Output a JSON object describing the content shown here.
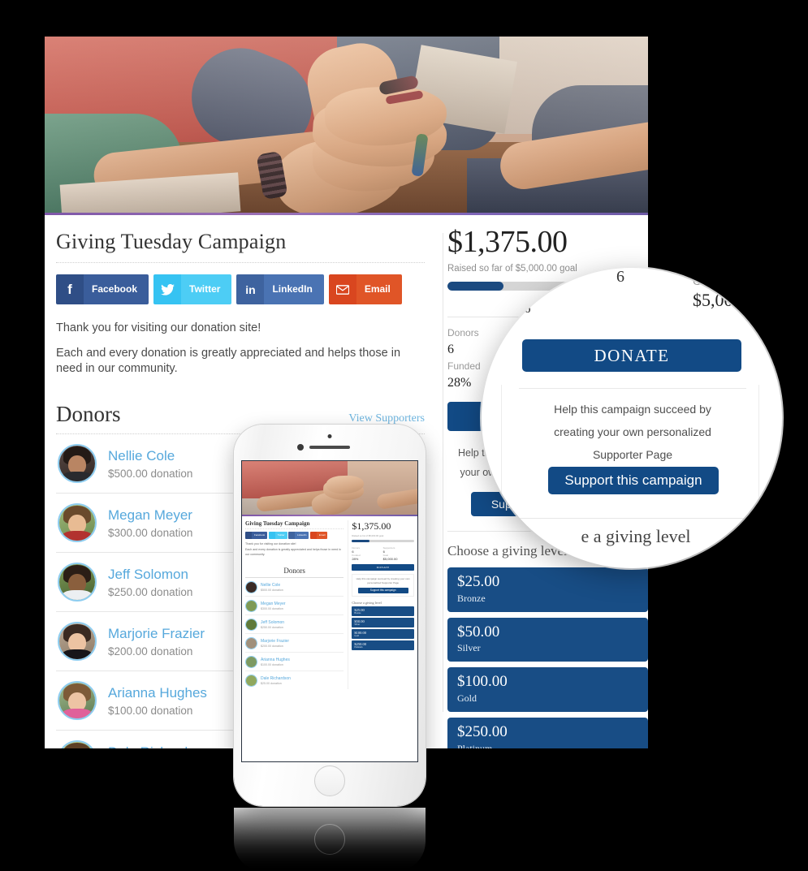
{
  "campaign": {
    "title": "Giving Tuesday Campaign",
    "intro_1": "Thank you for visiting our donation site!",
    "intro_2": "Each and every donation is greatly appreciated and helps those in need in our community."
  },
  "social": [
    {
      "name": "facebook",
      "glyph": "f",
      "label": "Facebook"
    },
    {
      "name": "twitter",
      "glyph": "ᵠ",
      "label": "Twitter"
    },
    {
      "name": "linkedin",
      "glyph": "in",
      "label": "LinkedIn"
    },
    {
      "name": "email",
      "glyph": "✉",
      "label": "Email"
    }
  ],
  "donors_section": {
    "heading": "Donors",
    "view_supporters": "View Supporters",
    "list": [
      {
        "name": "Nellie Cole",
        "amount": "$500.00 donation"
      },
      {
        "name": "Megan Meyer",
        "amount": "$300.00 donation"
      },
      {
        "name": "Jeff Solomon",
        "amount": "$250.00 donation"
      },
      {
        "name": "Marjorie Frazier",
        "amount": "$200.00 donation"
      },
      {
        "name": "Arianna Hughes",
        "amount": "$100.00 donation"
      },
      {
        "name": "Dale Richardson",
        "amount": "$25.00 donation"
      }
    ]
  },
  "progress": {
    "amount_raised": "$1,375.00",
    "raised_subtitle": "Raised so far of $5,000.00 goal",
    "percent_fill": 28,
    "percent_label": "%",
    "donors_label": "Donors",
    "donors_value": "6",
    "supporters_label": "Supporters",
    "supporters_value": "6",
    "funded_label": "Funded",
    "funded_value": "28%",
    "goal_label": "Goal",
    "goal_value": "$5,000.00"
  },
  "actions": {
    "donate": "DONATE",
    "help_text": "Help this campaign succeed by creating your own personalized Supporter Page",
    "help_line_1": "Help this campaign succeed by",
    "help_line_2": "creating your own personalized",
    "help_line_3": "Supporter Page",
    "support": "Support this campaign",
    "support_short": "Sup"
  },
  "giving": {
    "heading": "Choose a giving level",
    "heading_partial": "e a giving level",
    "levels": [
      {
        "amount": "$25.00",
        "tier": "Bronze"
      },
      {
        "amount": "$50.00",
        "tier": "Silver"
      },
      {
        "amount": "$100.00",
        "tier": "Gold"
      },
      {
        "amount": "$250.00",
        "tier": "Platinum"
      }
    ]
  },
  "colors": {
    "navy": "#124a85",
    "level_blue": "#184d85",
    "progress_fill": "#1b4a80",
    "progress_track": "#d5d5d5",
    "donor_link": "#56a8dc",
    "supporters_link": "#6fb6e0",
    "facebook": "#3a5d9b",
    "twitter": "#4dcdf5",
    "linkedin": "#4a73b3",
    "email": "#e05527",
    "hero_underline": "#7e57a8",
    "page_background": "#000000"
  }
}
